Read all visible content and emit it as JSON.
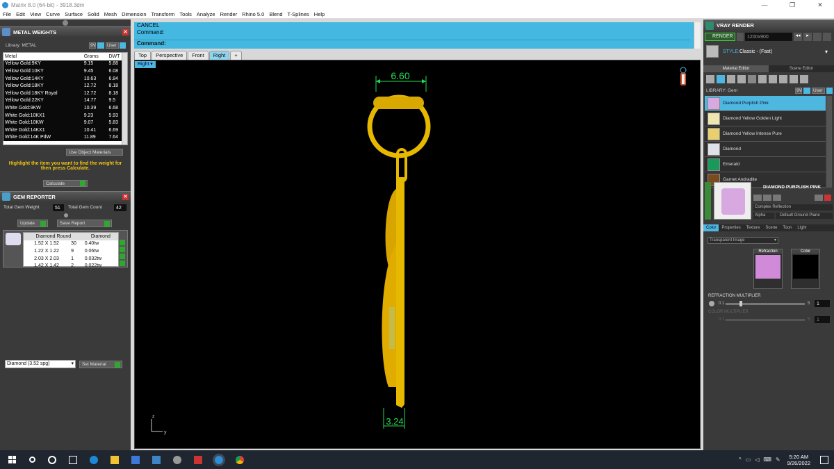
{
  "window": {
    "title": "Matrix 8.0 (64-bit) - 3918.3dm",
    "minimize": "—",
    "maximize": "❐",
    "close": "✕"
  },
  "menu": [
    "File",
    "Edit",
    "View",
    "Curve",
    "Surface",
    "Solid",
    "Mesh",
    "Dimension",
    "Transform",
    "Tools",
    "Analyze",
    "Render",
    "Rhino 5.0",
    "Blend",
    "T-Splines",
    "Help"
  ],
  "metal_weights": {
    "title": "METAL WEIGHTS",
    "library_label": "Library: METAL",
    "lib_btn_a": "9V",
    "lib_btn_b": "User",
    "columns": [
      "Metal",
      "Grams",
      "DWT"
    ],
    "rows": [
      [
        "Yellow Gold:9KY",
        "9.15",
        "5.88"
      ],
      [
        "Yellow Gold:10KY",
        "9.45",
        "6.08"
      ],
      [
        "Yellow Gold:14KY",
        "10.63",
        "6.84"
      ],
      [
        "Yellow Gold:18KY",
        "12.72",
        "8.18"
      ],
      [
        "Yellow Gold:18KY Royal",
        "12.72",
        "8.18"
      ],
      [
        "Yellow Gold:22KY",
        "14.77",
        "9.5"
      ],
      [
        "White Gold:9KW",
        "10.39",
        "6.68"
      ],
      [
        "White Gold:10KX1",
        "9.23",
        "5.93"
      ],
      [
        "White Gold:10KW",
        "9.07",
        "5.83"
      ],
      [
        "White Gold:14KX1",
        "10.41",
        "6.69"
      ],
      [
        "White Gold:14K PdW",
        "11.89",
        "7.64"
      ]
    ],
    "use_object_materials": "Use Object Materials",
    "hint": "Highlight the item you want to find the weight for then press Calculate.",
    "calculate": "Calculate"
  },
  "gem_reporter": {
    "title": "GEM REPORTER",
    "total_weight_label": "Total Gem Weight",
    "total_weight_value": "51",
    "total_count_label": "Total Gem Count",
    "total_count_value": "42",
    "update": "Update",
    "save_report": "Save Report",
    "col_shape": "Diamond Round",
    "col_type": "Diamond",
    "rows": [
      [
        "1.52 X 1.52",
        "30",
        "0.40tw"
      ],
      [
        "1.22 X 1.22",
        "9",
        "0.06tw"
      ],
      [
        "2.03 X 2.03",
        "1",
        "0.032tw"
      ],
      [
        "1.42 X 1.42",
        "2",
        "0.022tw"
      ]
    ],
    "material_select": "Diamond      (3.52 spg)",
    "set_material": "Set Material"
  },
  "command": {
    "line1": "CANCEL",
    "line2": "Command:",
    "prompt": "Command:"
  },
  "viewport_tabs": [
    "Top",
    "Perspective",
    "Front",
    "Right",
    "+"
  ],
  "active_tab": "Right",
  "viewport_label": "Right",
  "dimensions": {
    "top": "6.60",
    "bottom": "3.24"
  },
  "axes": {
    "z": "z",
    "y": "y"
  },
  "vray": {
    "title": "VRAY RENDER",
    "render": "RENDER",
    "resolution": "1200x900",
    "style_label": "STYLE:",
    "style_value": "Classic - (Fast)",
    "tab_material": "Material Editor",
    "tab_scene": "Scene Editor",
    "library_label": "LIBRARY: Gem",
    "lib_btn_a": "9V",
    "lib_btn_b": "User",
    "materials": [
      "Diamond Purplish Pink",
      "Diamond Yellow Golden Light",
      "Diamond Yellow Intense Pure",
      "Diamond",
      "Emerald",
      "Garnet Andradite"
    ],
    "selected_name": "DIAMOND PURPLISH PINK",
    "reflection": "Complex Reflection",
    "alpha": "Alpha",
    "ground": "Default Ground Plane",
    "prop_tabs": [
      "Color",
      "Properties",
      "Texture",
      "Scene",
      "Toon",
      "Light"
    ],
    "transparent_select": "Transparent Image",
    "refraction": "Refraction",
    "color": "Color",
    "refraction_multiplier": "REFRACTION MULTIPLIER",
    "rm_min": "0.1",
    "rm_max": "5",
    "rm_value": "1",
    "color_multiplier": "COLOR MULTIPLIER",
    "cm_min": "0.1",
    "cm_max": "5",
    "cm_value": "1"
  },
  "taskbar": {
    "time": "5:20 AM",
    "date": "9/26/2022"
  },
  "colors": {
    "accent": "#44b8e0",
    "gold": "#e6b800",
    "green": "#2fa82f",
    "highlight_text": "#f1c40f"
  }
}
